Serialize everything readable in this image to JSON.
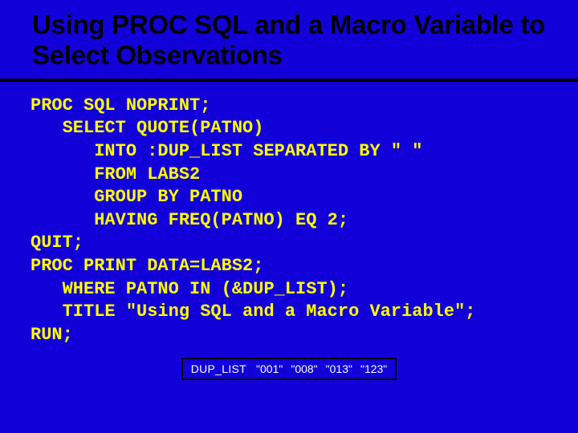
{
  "title": "Using PROC SQL and a Macro Variable to Select Observations",
  "code": "PROC SQL NOPRINT;\n   SELECT QUOTE(PATNO)\n      INTO :DUP_LIST SEPARATED BY \" \"\n      FROM LABS2\n      GROUP BY PATNO\n      HAVING FREQ(PATNO) EQ 2;\nQUIT;\nPROC PRINT DATA=LABS2;\n   WHERE PATNO IN (&DUP_LIST);\n   TITLE \"Using SQL and a Macro Variable\";\nRUN;",
  "footer": {
    "label": "DUP_LIST",
    "values": [
      "\"001\"",
      "\"008\"",
      "\"013\"",
      "\"123\""
    ]
  }
}
